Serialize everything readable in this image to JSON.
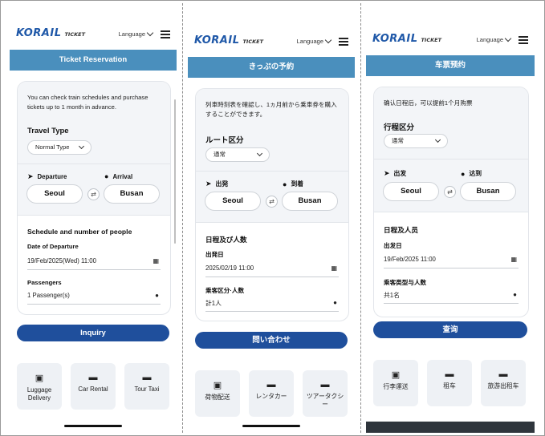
{
  "panels": [
    {
      "language": "Language",
      "title": "Ticket Reservation",
      "intro": "You can check train schedules and purchase tickets up to 1 month in advance.",
      "travel_type_label": "Travel Type",
      "travel_type_value": "Normal Type",
      "departure_label": "Departure",
      "arrival_label": "Arrival",
      "departure_station": "Seoul",
      "arrival_station": "Busan",
      "schedule_title": "Schedule and number of people",
      "date_label": "Date of Departure",
      "date_value": "19/Feb/2025(Wed) 11:00",
      "passengers_label": "Passengers",
      "passengers_value": "1 Passenger(s)",
      "inquiry": "Inquiry",
      "services": [
        "Luggage Delivery",
        "Car Rental",
        "Tour Taxi"
      ]
    },
    {
      "language": "Language",
      "title": "きっぷの予約",
      "intro": "列車時刻表を確認し、1ヵ月前から乗車券を購入することができます。",
      "travel_type_label": "ルート区分",
      "travel_type_value": "通常",
      "departure_label": "出発",
      "arrival_label": "到着",
      "departure_station": "Seoul",
      "arrival_station": "Busan",
      "schedule_title": "日程及び人数",
      "date_label": "出発日",
      "date_value": "2025/02/19 11:00",
      "passengers_label": "乗客区分·人数",
      "passengers_value": "計1人",
      "inquiry": "問い合わせ",
      "services": [
        "荷物配送",
        "レンタカー",
        "ツアータクシー"
      ]
    },
    {
      "language": "Language",
      "title": "车票预约",
      "intro": "确认日程后，可以提前1个月购票",
      "travel_type_label": "行程区分",
      "travel_type_value": "通常",
      "departure_label": "出发",
      "arrival_label": "达到",
      "departure_station": "Seoul",
      "arrival_station": "Busan",
      "schedule_title": "日程及人员",
      "date_label": "出发日",
      "date_value": "19/Feb/2025 11:00",
      "passengers_label": "乘客类型与人数",
      "passengers_value": "共1名",
      "inquiry": "查询",
      "services": [
        "行李運送",
        "租车",
        "旅游出租车"
      ]
    }
  ],
  "brand": {
    "logo": "KORAIL",
    "logo_sub": "TICKET"
  },
  "icons": {
    "departure": "navigation-arrow-icon",
    "arrival": "location-pin-icon",
    "swap": "swap-icon",
    "calendar": "calendar-icon",
    "person": "person-icon",
    "luggage": "luggage-icon",
    "car": "car-icon",
    "taxi": "taxi-icon",
    "menu": "hamburger-menu-icon",
    "chevron": "chevron-down-icon"
  },
  "colors": {
    "brand_blue": "#1f58a8",
    "title_bar": "#4a8fbd",
    "button": "#1f4f9c",
    "card_tint": "#f3f5f8"
  }
}
